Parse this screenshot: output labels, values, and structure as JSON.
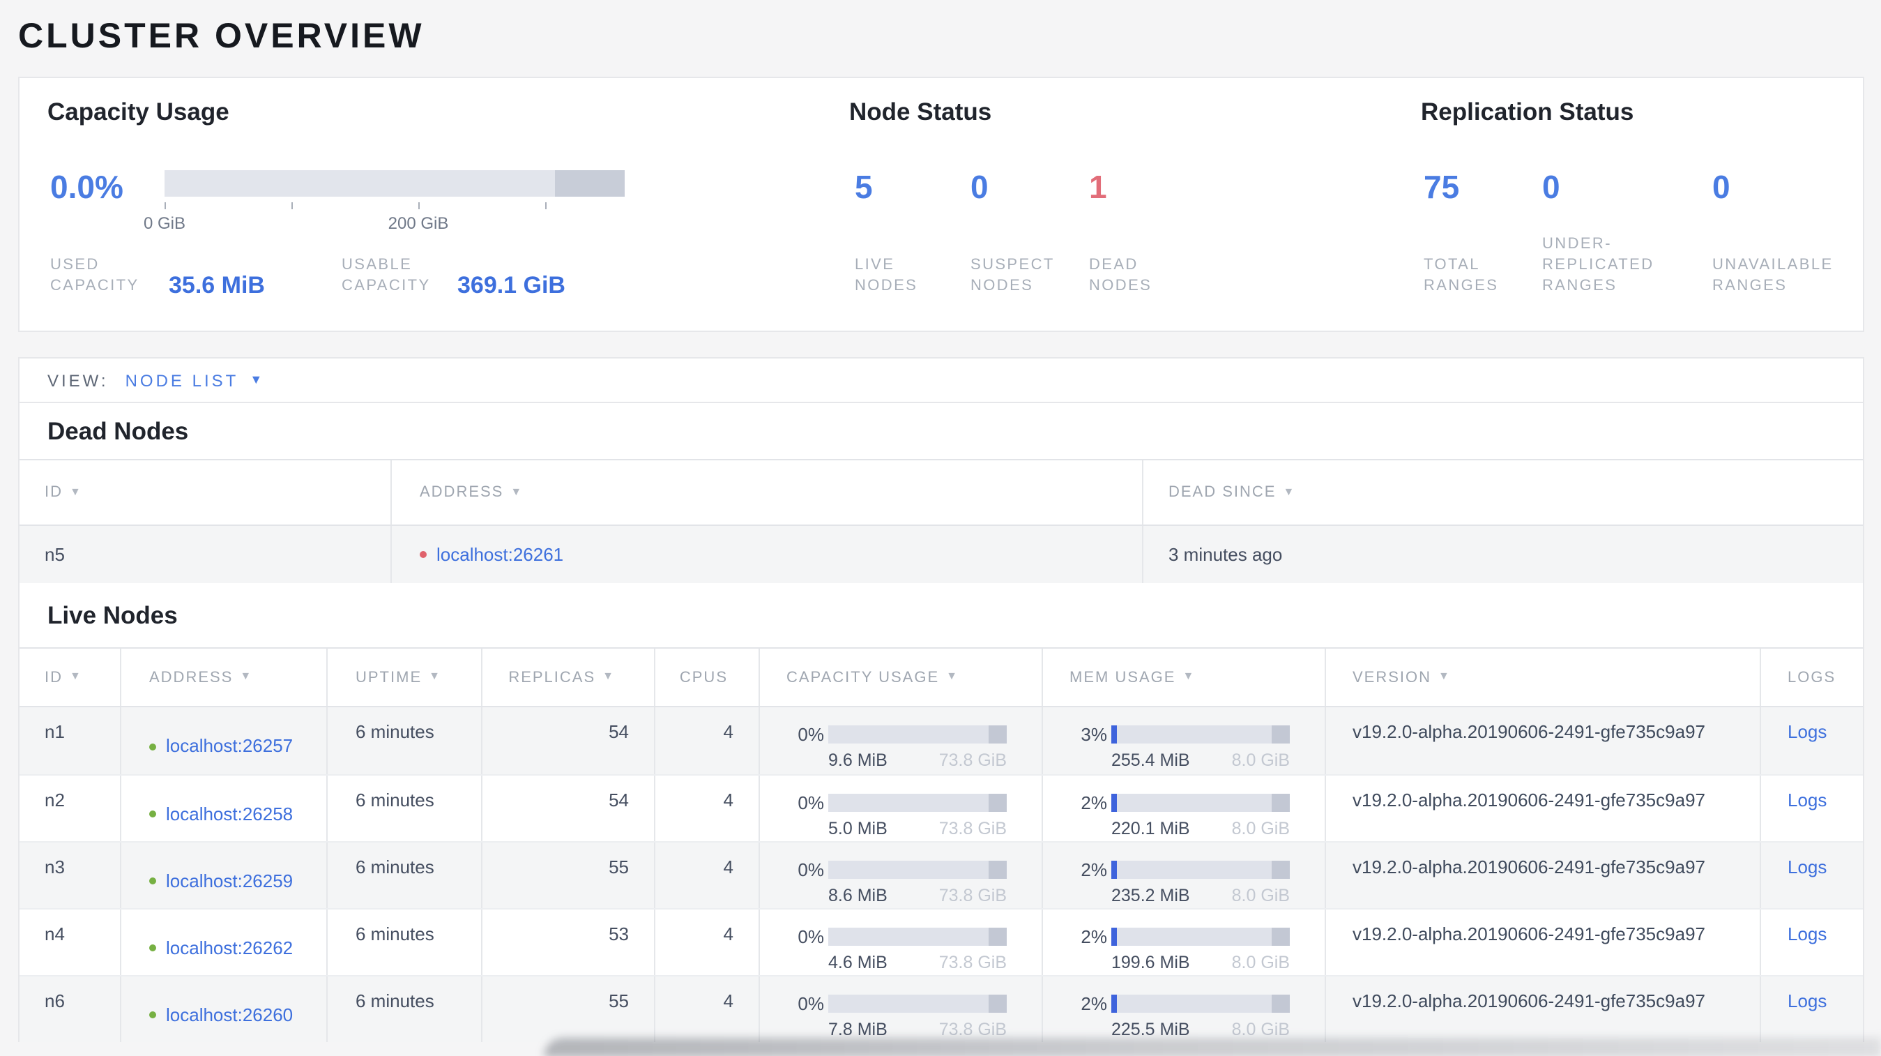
{
  "colors": {
    "accent_blue": "#4a7ce2",
    "link_blue": "#3d6fdd",
    "dead_red": "#e26d79",
    "live_dot_green": "#76b042",
    "dead_dot_red": "#e0626c",
    "bar_track": "#dfe2ea",
    "bar_used_fill": "#3e63dc",
    "bar_end_cap": "#c3c8d4",
    "page_bg": "#f5f5f6"
  },
  "page": {
    "title": "CLUSTER OVERVIEW"
  },
  "capacity": {
    "heading": "Capacity Usage",
    "percent": "0.0%",
    "percent_num": 0,
    "ticks": [
      "0 GiB",
      "200 GiB"
    ],
    "stats": [
      {
        "lines": [
          "USED",
          "CAPACITY"
        ],
        "value": "35.6 MiB"
      },
      {
        "lines": [
          "USABLE",
          "CAPACITY"
        ],
        "value": "369.1 GiB"
      }
    ]
  },
  "node_status": {
    "heading": "Node Status",
    "stats": [
      {
        "value": "5",
        "lines": [
          "LIVE",
          "NODES"
        ]
      },
      {
        "value": "0",
        "lines": [
          "SUSPECT",
          "NODES"
        ]
      },
      {
        "value": "1",
        "lines": [
          "DEAD",
          "NODES"
        ]
      }
    ]
  },
  "replication": {
    "heading": "Replication Status",
    "stats": [
      {
        "value": "75",
        "lines": [
          "TOTAL",
          "RANGES"
        ]
      },
      {
        "value": "0",
        "lines": [
          "UNDER-",
          "REPLICATED",
          "RANGES"
        ]
      },
      {
        "value": "0",
        "lines": [
          "UNAVAILABLE",
          "RANGES"
        ]
      }
    ]
  },
  "view_bar": {
    "label": "VIEW:",
    "selected": "NODE LIST",
    "caret": "▼"
  },
  "sort_arrow": "▼",
  "dead_nodes": {
    "heading": "Dead Nodes",
    "columns": [
      "ID",
      "ADDRESS",
      "DEAD SINCE"
    ],
    "rows": [
      {
        "id": "n5",
        "address": "localhost:26261",
        "dead_since": "3 minutes ago"
      }
    ]
  },
  "live_nodes": {
    "heading": "Live Nodes",
    "columns": [
      "ID",
      "ADDRESS",
      "UPTIME",
      "REPLICAS",
      "CPUS",
      "CAPACITY USAGE",
      "MEM USAGE",
      "VERSION",
      "LOGS"
    ],
    "rows": [
      {
        "id": "n1",
        "address": "localhost:26257",
        "uptime": "6 minutes",
        "replicas": "54",
        "cpus": "4",
        "capacity": {
          "pct": "0%",
          "pct_num": 0,
          "used": "9.6 MiB",
          "total": "73.8 GiB"
        },
        "mem": {
          "pct": "3%",
          "pct_num": 3,
          "used": "255.4 MiB",
          "total": "8.0 GiB"
        },
        "version": "v19.2.0-alpha.20190606-2491-gfe735c9a97",
        "logs": "Logs"
      },
      {
        "id": "n2",
        "address": "localhost:26258",
        "uptime": "6 minutes",
        "replicas": "54",
        "cpus": "4",
        "capacity": {
          "pct": "0%",
          "pct_num": 0,
          "used": "5.0 MiB",
          "total": "73.8 GiB"
        },
        "mem": {
          "pct": "2%",
          "pct_num": 2,
          "used": "220.1 MiB",
          "total": "8.0 GiB"
        },
        "version": "v19.2.0-alpha.20190606-2491-gfe735c9a97",
        "logs": "Logs"
      },
      {
        "id": "n3",
        "address": "localhost:26259",
        "uptime": "6 minutes",
        "replicas": "55",
        "cpus": "4",
        "capacity": {
          "pct": "0%",
          "pct_num": 0,
          "used": "8.6 MiB",
          "total": "73.8 GiB"
        },
        "mem": {
          "pct": "2%",
          "pct_num": 2,
          "used": "235.2 MiB",
          "total": "8.0 GiB"
        },
        "version": "v19.2.0-alpha.20190606-2491-gfe735c9a97",
        "logs": "Logs"
      },
      {
        "id": "n4",
        "address": "localhost:26262",
        "uptime": "6 minutes",
        "replicas": "53",
        "cpus": "4",
        "capacity": {
          "pct": "0%",
          "pct_num": 0,
          "used": "4.6 MiB",
          "total": "73.8 GiB"
        },
        "mem": {
          "pct": "2%",
          "pct_num": 2,
          "used": "199.6 MiB",
          "total": "8.0 GiB"
        },
        "version": "v19.2.0-alpha.20190606-2491-gfe735c9a97",
        "logs": "Logs"
      },
      {
        "id": "n6",
        "address": "localhost:26260",
        "uptime": "6 minutes",
        "replicas": "55",
        "cpus": "4",
        "capacity": {
          "pct": "0%",
          "pct_num": 0,
          "used": "7.8 MiB",
          "total": "73.8 GiB"
        },
        "mem": {
          "pct": "2%",
          "pct_num": 2,
          "used": "225.5 MiB",
          "total": "8.0 GiB"
        },
        "version": "v19.2.0-alpha.20190606-2491-gfe735c9a97",
        "logs": "Logs"
      }
    ]
  }
}
